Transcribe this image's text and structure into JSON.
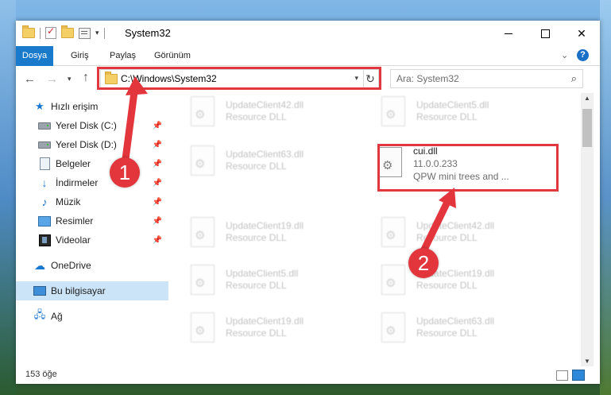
{
  "window": {
    "title": "System32"
  },
  "ribbon": {
    "tabs": [
      {
        "label": "Dosya"
      },
      {
        "label": "Giriş"
      },
      {
        "label": "Paylaş"
      },
      {
        "label": "Görünüm"
      }
    ]
  },
  "address": {
    "path": "C:\\Windows\\System32"
  },
  "search": {
    "placeholder": "Ara: System32"
  },
  "sidebar": {
    "items": [
      {
        "label": "Hızlı erişim",
        "icon": "star-icon"
      },
      {
        "label": "Yerel Disk (C:)",
        "icon": "drive-icon"
      },
      {
        "label": "Yerel Disk (D:)",
        "icon": "drive-icon"
      },
      {
        "label": "Belgeler",
        "icon": "document-icon"
      },
      {
        "label": "İndirmeler",
        "icon": "download-icon"
      },
      {
        "label": "Müzik",
        "icon": "music-icon"
      },
      {
        "label": "Resimler",
        "icon": "pictures-icon"
      },
      {
        "label": "Videolar",
        "icon": "video-icon"
      },
      {
        "label": "OneDrive",
        "icon": "cloud-icon"
      },
      {
        "label": "Bu bilgisayar",
        "icon": "computer-icon"
      },
      {
        "label": "Ağ",
        "icon": "network-icon"
      }
    ]
  },
  "files": [
    {
      "name": "UpdateClient42.dll",
      "desc": "Resource DLL"
    },
    {
      "name": "UpdateClient5.dll",
      "desc": "Resource DLL"
    },
    {
      "name": "UpdateClient63.dll",
      "desc": "Resource DLL"
    },
    {
      "name": "cui.dll",
      "version": "11.0.0.233",
      "desc": "QPW mini trees and ..."
    },
    {
      "name": "UpdateClient19.dll",
      "desc": "Resource DLL"
    },
    {
      "name": "UpdateClient42.dll",
      "desc": "Resource DLL"
    },
    {
      "name": "UpdateClient5.dll",
      "desc": "Resource DLL"
    },
    {
      "name": "UpdateClient19.dll",
      "desc": "Resource DLL"
    },
    {
      "name": "UpdateClient19.dll",
      "desc": "Resource DLL"
    },
    {
      "name": "UpdateClient63.dll",
      "desc": "Resource DLL"
    }
  ],
  "status": {
    "count": "153 öğe"
  },
  "markers": [
    {
      "label": "1"
    },
    {
      "label": "2"
    }
  ],
  "colors": {
    "accent": "#1979ca",
    "highlight": "#e0383e"
  }
}
